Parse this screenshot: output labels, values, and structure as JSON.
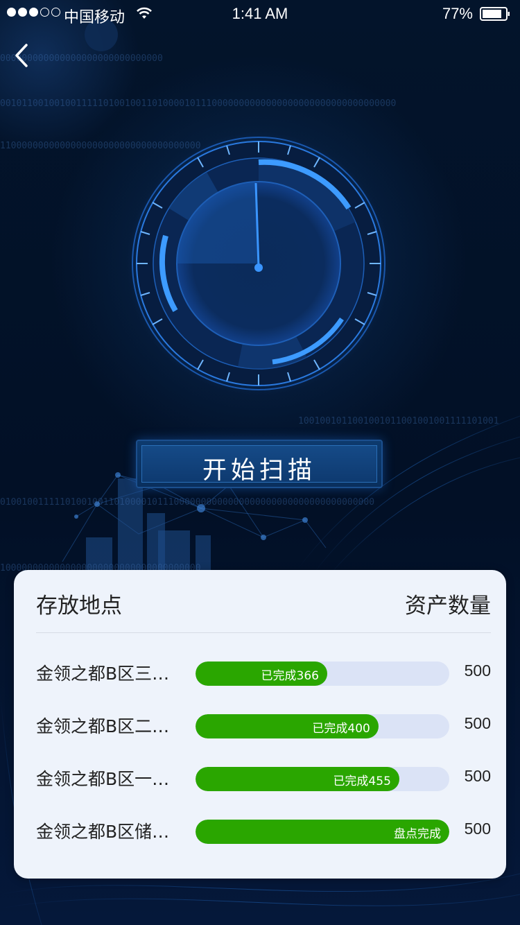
{
  "status_bar": {
    "carrier": "中国移动",
    "time": "1:41 AM",
    "battery": "77%",
    "signal_bars_filled": 3,
    "signal_bars_total": 5
  },
  "background": {
    "binary_lines": [
      "000000000000000000000000000000",
      "0010110010010011111010010011010000101110000000000000000000000000000000000",
      "1100000000000000000000000000000000000",
      "1001001011001001011001001001111101001",
      "010010011111010010011010000101110000000000000000000000000000000000000",
      "1000000000000000000000000000000000000"
    ]
  },
  "scan_button": {
    "label": "开始扫描"
  },
  "table": {
    "header_left": "存放地点",
    "header_right": "资产数量",
    "rows": [
      {
        "name": "金领之都B区三…",
        "progress_label": "已完成366",
        "progress": 0.519,
        "count": "500"
      },
      {
        "name": "金领之都B区二…",
        "progress_label": "已完成400",
        "progress": 0.721,
        "count": "500"
      },
      {
        "name": "金领之都B区一…",
        "progress_label": "已完成455",
        "progress": 0.803,
        "count": "500"
      },
      {
        "name": "金领之都B区储…",
        "progress_label": "盘点完成",
        "progress": 1.0,
        "count": "500"
      }
    ]
  },
  "colors": {
    "accent_blue": "#1e7be6",
    "progress_green": "#2aa600",
    "track": "#dbe3f6",
    "card_bg": "#eef3fb"
  },
  "icons": {
    "back": "chevron-left-icon",
    "wifi": "wifi-icon",
    "battery": "battery-icon"
  }
}
